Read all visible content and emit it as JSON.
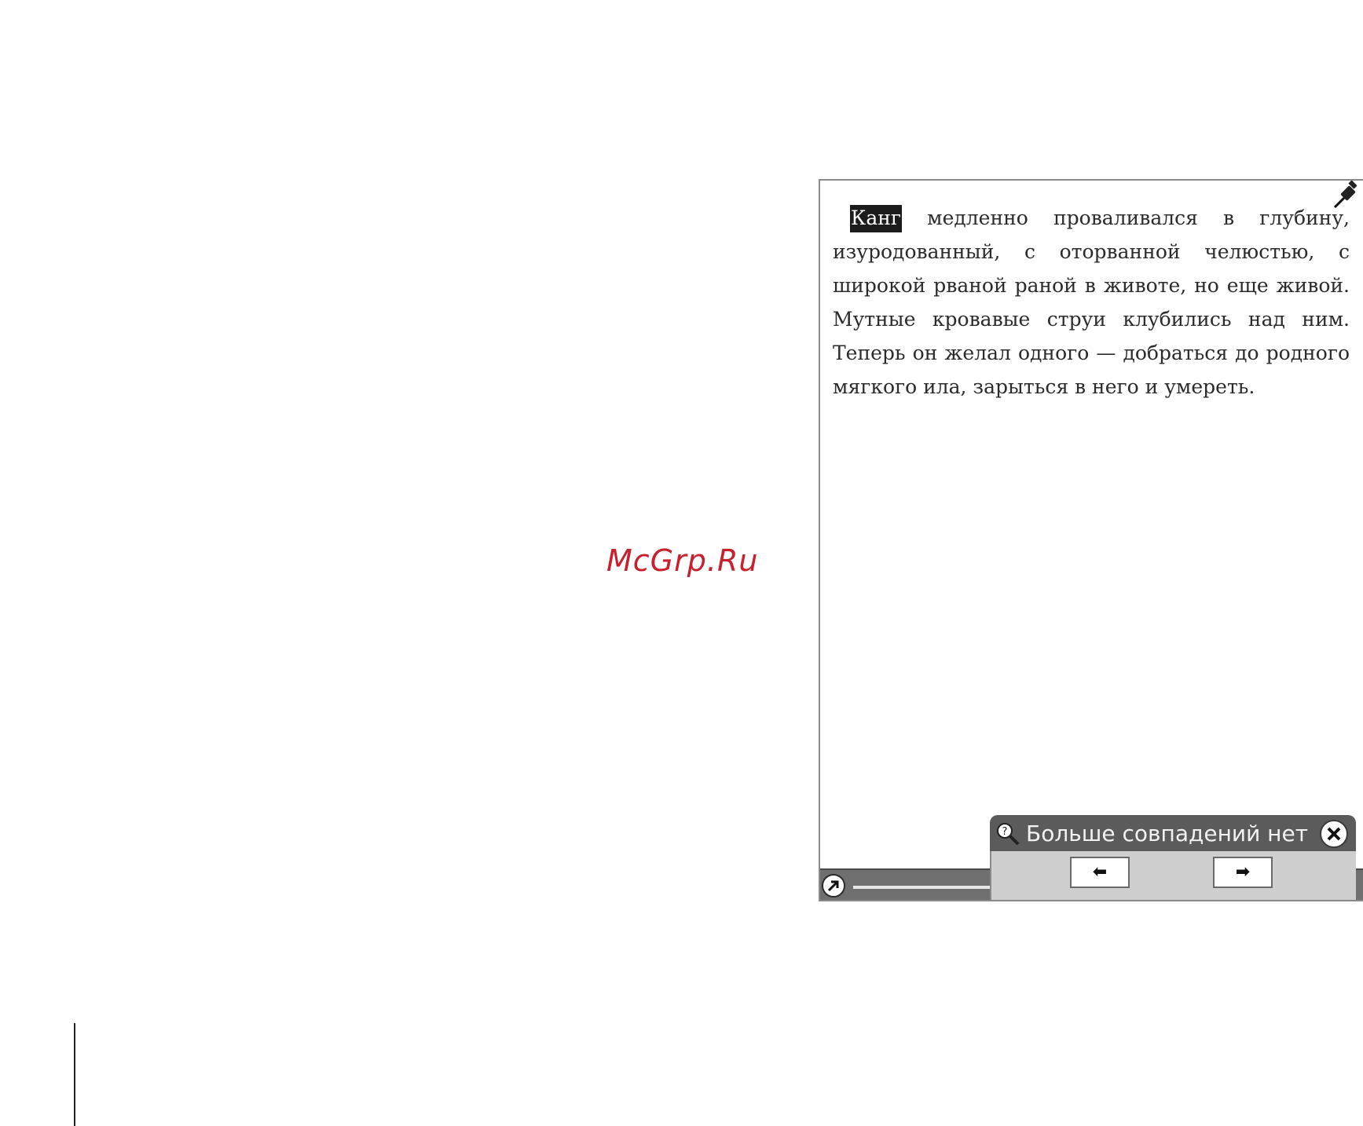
{
  "watermark": {
    "text": "McGrp.Ru"
  },
  "reader": {
    "highlighted_word": "Канг",
    "paragraph_rest": " медленно проваливался в глубину, изуродованный, с оторванной челюстью, с широкой рваной раной в животе, но еще живой. Мутные кровавые струи клубились над ним. Теперь он желал одного — добраться до родного мягкого ила, зарыться в него и умереть."
  },
  "search": {
    "message": "Больше совпадений нет",
    "prev_label": "⬅",
    "next_label": "➡"
  },
  "icons": {
    "pin": "pushpin-icon",
    "search": "magnifier-icon",
    "close": "close-icon",
    "go": "go-to-icon"
  }
}
